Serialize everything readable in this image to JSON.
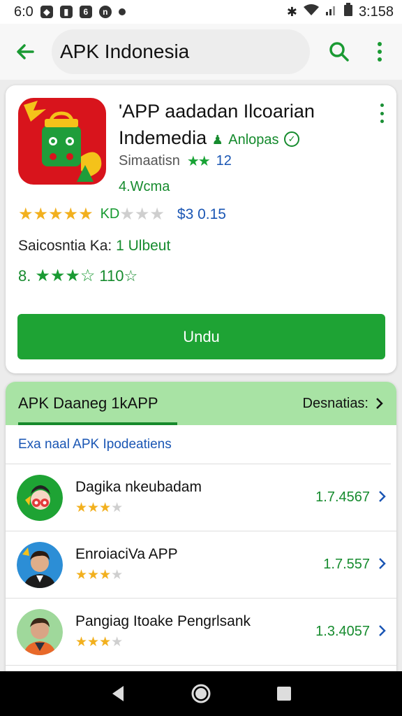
{
  "status_bar": {
    "time_left": "6:0",
    "time_right": "3:158"
  },
  "app_bar": {
    "title": "APK Indonesia",
    "icons": [
      "back-arrow-icon",
      "search-icon",
      "more-vert-icon"
    ]
  },
  "app": {
    "title_line1": "'APP aadadan Ilcoarian",
    "title_line2": "Indemedia",
    "developer": "Anlopas",
    "meta_label": "Simaatisn",
    "meta_stars": "★★",
    "meta_count": "12",
    "category": "4.Wcma",
    "rating_stars_filled": "★★★★★",
    "rating_stars_empty": "★★★",
    "rating_code": "KD",
    "price": "$3 0.15",
    "sales_label": "Saicosntia Ka:",
    "sales_value": "1 Ulbeut",
    "score_prefix": "8.",
    "score_stars": "★★★☆",
    "score_value": "110☆",
    "download_label": "Undu",
    "accent_color": "#1ea334"
  },
  "list": {
    "tab_label": "APK Daaneg 1kAPP",
    "see_more_label": "Desnatias:",
    "subtitle": "Exa naal APK Ipodeatiens",
    "items": [
      {
        "name": "Dagika nkeubadam",
        "stars_filled": "★★★",
        "stars_empty": "★",
        "version": "1.7.4567"
      },
      {
        "name": "EnroiaciVa APP",
        "stars_filled": "★★★",
        "stars_empty": "★",
        "version": "1.7.557"
      },
      {
        "name": "Pangiag Itoake Pengrlsank",
        "stars_filled": "★★★",
        "stars_empty": "★",
        "version": "1.3.4057"
      }
    ]
  }
}
